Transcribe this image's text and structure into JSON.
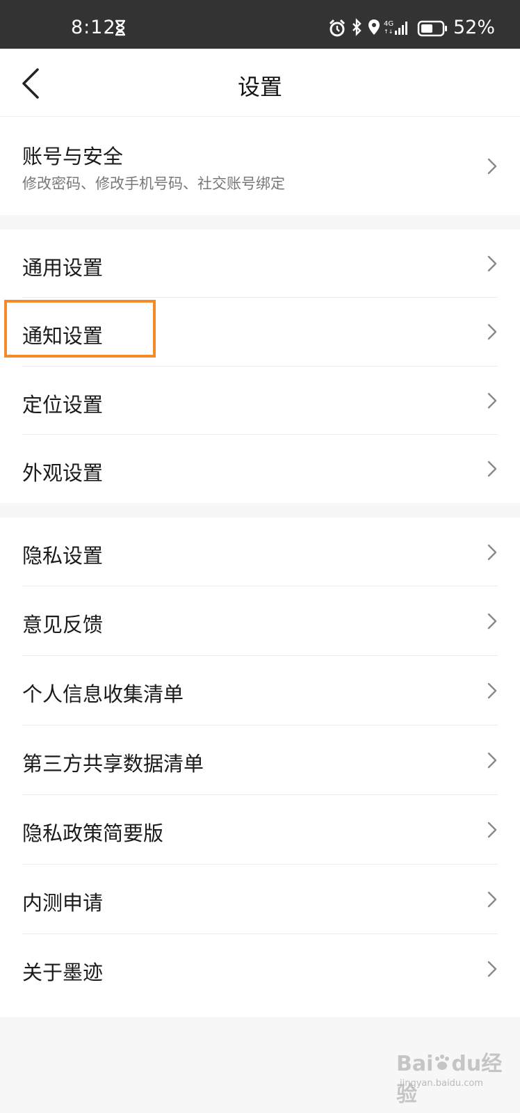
{
  "status_bar": {
    "time": "8:12",
    "battery": "52%",
    "icons": [
      "hourglass-icon",
      "alarm-icon",
      "bluetooth-icon",
      "location-icon",
      "network-4g-icon",
      "signal-icon",
      "battery-icon"
    ]
  },
  "header": {
    "title": "设置",
    "back_icon": "back-arrow-icon"
  },
  "account": {
    "label": "账号与安全",
    "sub": "修改密码、修改手机号码、社交账号绑定"
  },
  "group1": {
    "items": [
      {
        "label": "通用设置"
      },
      {
        "label": "通知设置"
      },
      {
        "label": "定位设置"
      },
      {
        "label": "外观设置"
      }
    ]
  },
  "group2": {
    "items": [
      {
        "label": "隐私设置"
      },
      {
        "label": "意见反馈"
      },
      {
        "label": "个人信息收集清单"
      },
      {
        "label": "第三方共享数据清单"
      },
      {
        "label": "隐私政策简要版"
      },
      {
        "label": "内测申请"
      },
      {
        "label": "关于墨迹"
      }
    ]
  },
  "watermark": {
    "brand": "Bai",
    "brand2": "du",
    "suffix": "经验",
    "url": "jingyan.baidu.com"
  },
  "colors": {
    "status_bg": "#333333",
    "highlight": "#f58a2a",
    "page_bg": "#f7f7f7"
  }
}
